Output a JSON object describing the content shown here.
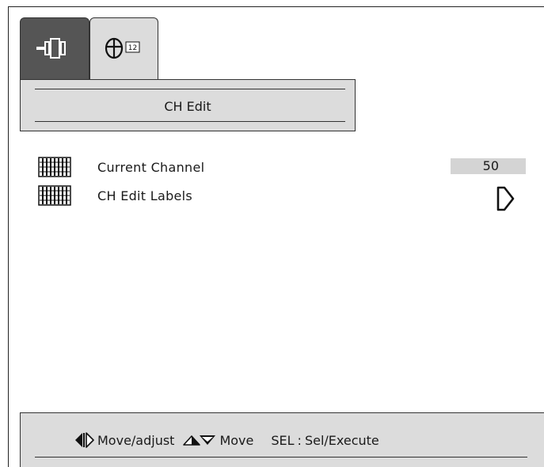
{
  "tabs": [
    {
      "icon": "connector-icon",
      "active": true
    },
    {
      "icon": "globe-icon",
      "badge": "12",
      "active": false
    }
  ],
  "panel": {
    "title": "CH Edit"
  },
  "menu": {
    "items": [
      {
        "label": "Current Channel",
        "value": "50",
        "icon": "grid-icon"
      },
      {
        "label": "CH Edit Labels",
        "icon": "grid-icon",
        "action_icon": "chevron-right-icon"
      }
    ]
  },
  "help": {
    "move_adjust": "Move/adjust",
    "move": "Move",
    "sel_key": "SEL",
    "separator": ":",
    "sel_action": "Sel/Execute"
  },
  "colors": {
    "active_tab": "#555555",
    "panel_bg": "#dcdcdc",
    "value_bg": "#d4d4d4",
    "text": "#1a1a1a"
  }
}
